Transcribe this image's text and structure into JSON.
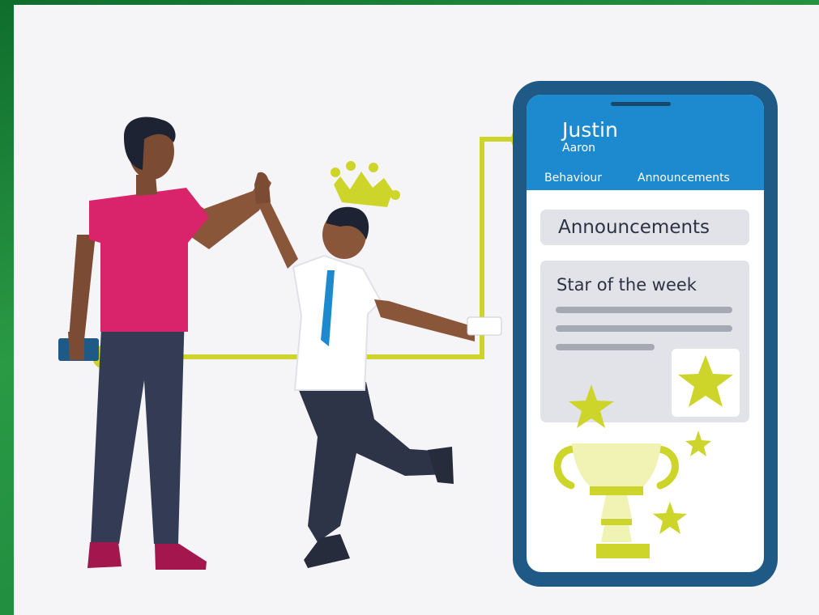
{
  "phone": {
    "user_name": "Justin",
    "user_sub": "Aaron",
    "tabs": [
      "Behaviour",
      "Announcements"
    ],
    "section_heading": "Announcements",
    "card_title": "Star of the week"
  },
  "colors": {
    "background_frame": "#1e8a3a",
    "panel": "#f5f5f8",
    "phone_header": "#1d89cf",
    "phone_frame": "#1e5a85",
    "accent_lime": "#cdd52a",
    "shirt_pink": "#d9236a"
  },
  "icons": [
    "crown-icon",
    "star-icon",
    "trophy-icon",
    "smartphone-icon",
    "card-icon"
  ]
}
